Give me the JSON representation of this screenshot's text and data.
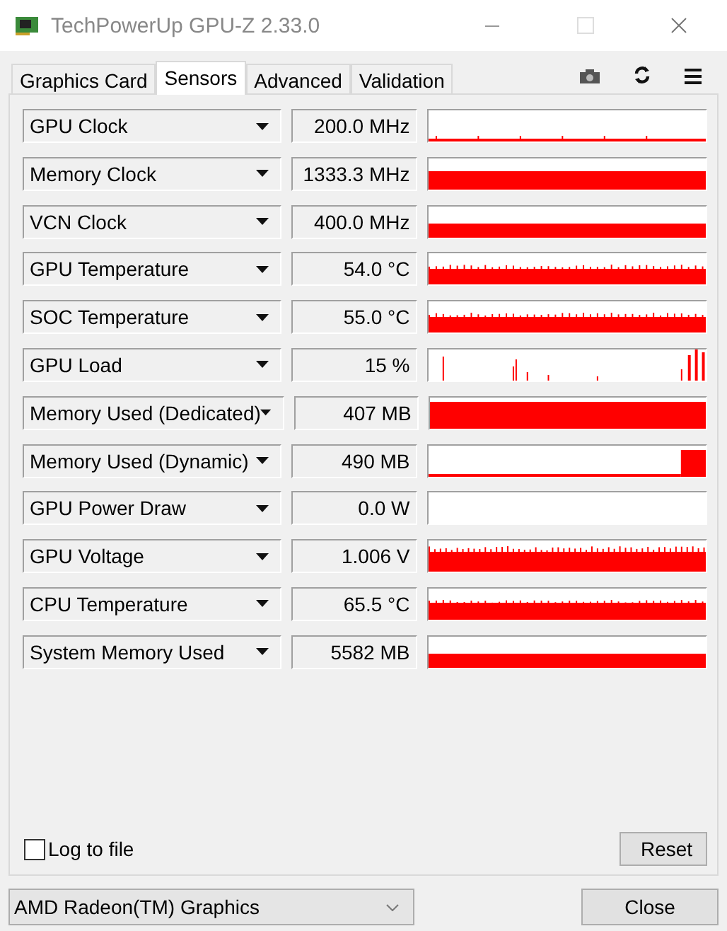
{
  "window": {
    "title": "TechPowerUp GPU-Z 2.33.0"
  },
  "tabs": [
    {
      "label": "Graphics Card",
      "selected": false
    },
    {
      "label": "Sensors",
      "selected": true
    },
    {
      "label": "Advanced",
      "selected": false
    },
    {
      "label": "Validation",
      "selected": false
    }
  ],
  "sensors": [
    {
      "name": "GPU Clock",
      "reading": "200.0 MHz"
    },
    {
      "name": "Memory Clock",
      "reading": "1333.3 MHz"
    },
    {
      "name": "VCN Clock",
      "reading": "400.0 MHz"
    },
    {
      "name": "GPU Temperature",
      "reading": "54.0 °C"
    },
    {
      "name": "SOC Temperature",
      "reading": "55.0 °C"
    },
    {
      "name": "GPU Load",
      "reading": "15 %"
    },
    {
      "name": "Memory Used (Dedicated)",
      "reading": "407 MB"
    },
    {
      "name": "Memory Used (Dynamic)",
      "reading": "490 MB"
    },
    {
      "name": "GPU Power Draw",
      "reading": "0.0 W"
    },
    {
      "name": "GPU Voltage",
      "reading": "1.006 V"
    },
    {
      "name": "CPU Temperature",
      "reading": "65.5 °C"
    },
    {
      "name": "System Memory Used",
      "reading": "5582 MB"
    }
  ],
  "log_to_file": {
    "label": "Log to file",
    "checked": false
  },
  "reset_button": "Reset",
  "device_select": {
    "value": "AMD Radeon(TM) Graphics"
  },
  "close_button": "Close"
}
